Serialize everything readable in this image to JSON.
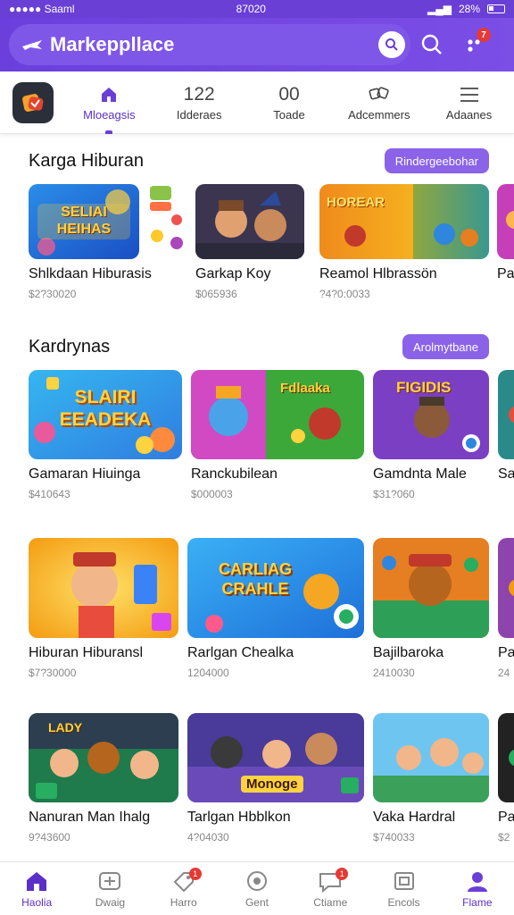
{
  "status": {
    "carrier": "●●●●● Saaml",
    "time": "87020",
    "battery": "28%"
  },
  "appbar": {
    "title": "Markeppllace",
    "notif_count": "7"
  },
  "tabs": [
    {
      "icon": "home-icon",
      "num": "",
      "label": "Mloeagsis"
    },
    {
      "icon": "",
      "num": "122",
      "label": "Idderaes"
    },
    {
      "icon": "",
      "num": "00",
      "label": "Toade"
    },
    {
      "icon": "dice-icon",
      "num": "",
      "label": "Adcemmers"
    },
    {
      "icon": "menu-icon",
      "num": "",
      "label": "Adaanes"
    }
  ],
  "sections": [
    {
      "title": "Karga Hiburan",
      "action": "Rindergeebohar",
      "cards": [
        {
          "title": "Shlkdaan Hiburasis",
          "price": "$2?30020",
          "art": "SELIAI HEIHAS"
        },
        {
          "title": "Garkap Koy",
          "price": "$065936",
          "art": ""
        },
        {
          "title": "Reamol Hlbrassön",
          "price": "?4?0:0033",
          "art": "HOREAR"
        },
        {
          "title": "Pa",
          "price": "",
          "art": ""
        }
      ]
    },
    {
      "title": "Kardrynas",
      "action": "Arolmytbane",
      "cards": [
        {
          "title": "Gamaran Hiuinga",
          "price": "$410643",
          "art": "SLAIRI EEADEKA"
        },
        {
          "title": "Ranckubilean",
          "price": "$000003",
          "art": "Fdlaaka"
        },
        {
          "title": "Gamdnta Male",
          "price": "$31?060",
          "art": "FIGIDIS"
        },
        {
          "title": "Sa",
          "price": "",
          "art": ""
        }
      ]
    }
  ],
  "rows": [
    {
      "cards": [
        {
          "title": "Hiburan Hiburansl",
          "price": "$7?30000",
          "art": ""
        },
        {
          "title": "Rarlgan Chealka",
          "price": "1204000",
          "art": "CARLIAG CRAHLE"
        },
        {
          "title": "Bajilbaroka",
          "price": "2410030",
          "art": ""
        },
        {
          "title": "Pa",
          "price": "24",
          "art": ""
        }
      ]
    },
    {
      "cards": [
        {
          "title": "Nanuran Man Ihalg",
          "price": "9?43600",
          "art": "LADY"
        },
        {
          "title": "Tarlgan Hbblkon",
          "price": "4?04030",
          "art": "Monoge"
        },
        {
          "title": "Vaka Hardral",
          "price": "$740033",
          "art": ""
        },
        {
          "title": "Pa",
          "price": "$2",
          "art": ""
        }
      ]
    }
  ],
  "bottom_nav": [
    {
      "label": "Haolia",
      "icon": "home-icon",
      "badge": ""
    },
    {
      "label": "Dwaig",
      "icon": "gamepad-icon",
      "badge": ""
    },
    {
      "label": "Harro",
      "icon": "tag-icon",
      "badge": "1"
    },
    {
      "label": "Gent",
      "icon": "coin-icon",
      "badge": ""
    },
    {
      "label": "Ctiame",
      "icon": "chat-icon",
      "badge": "1"
    },
    {
      "label": "Encols",
      "icon": "store-icon",
      "badge": ""
    },
    {
      "label": "Flame",
      "icon": "profile-icon",
      "badge": ""
    }
  ],
  "colors": {
    "accent": "#6a3fd6",
    "badge": "#e53935",
    "pill": "#8a63e8"
  }
}
